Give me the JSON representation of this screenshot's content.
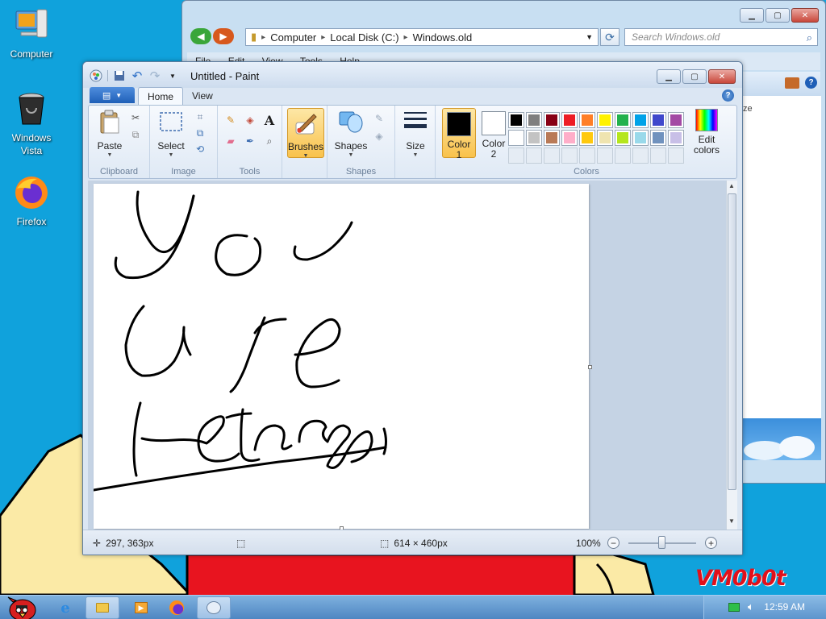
{
  "desktop": {
    "icons": [
      {
        "label": "Computer"
      },
      {
        "label": "Windows\nVista"
      },
      {
        "label": "Firefox"
      }
    ],
    "watermark": "VM0b0t"
  },
  "explorer": {
    "address_parts": [
      "Computer",
      "Local Disk (C:)",
      "Windows.old"
    ],
    "search_placeholder": "Search Windows.old",
    "menu": [
      "File",
      "Edit",
      "View",
      "Tools",
      "Help"
    ],
    "column_header_partial": "ze"
  },
  "paint": {
    "title": "Untitled - Paint",
    "tabs": [
      "Home",
      "View"
    ],
    "groups": {
      "clipboard": "Clipboard",
      "image": "Image",
      "tools": "Tools",
      "shapes": "Shapes",
      "colors": "Colors"
    },
    "buttons": {
      "paste": "Paste",
      "select": "Select",
      "brushes": "Brushes",
      "shapes": "Shapes",
      "size": "Size",
      "color1": "Color\n1",
      "color2": "Color\n2",
      "edit_colors": "Edit\ncolors"
    },
    "color1": "#000000",
    "color2": "#ffffff",
    "palette": [
      "#000000",
      "#7f7f7f",
      "#880015",
      "#ed1c24",
      "#ff7f27",
      "#fff200",
      "#22b14c",
      "#00a2e8",
      "#3f48cc",
      "#a349a4",
      "#ffffff",
      "#c3c3c3",
      "#b97a57",
      "#ffaec9",
      "#ffc90e",
      "#efe4b0",
      "#b5e61d",
      "#99d9ea",
      "#7092be",
      "#c8bfe7",
      "",
      "",
      "",
      "",
      "",
      "",
      "",
      "",
      "",
      ""
    ],
    "status": {
      "cursor_pos": "297, 363px",
      "selection_size": "",
      "image_size": "614 × 460px",
      "zoom": "100%"
    }
  },
  "taskbar": {
    "clock": "12:59 AM"
  },
  "colors": {
    "desktop_bg": "#10a2dc",
    "ribbon_highlight": "#f9c24c",
    "watermark_red": "#e2101b"
  }
}
